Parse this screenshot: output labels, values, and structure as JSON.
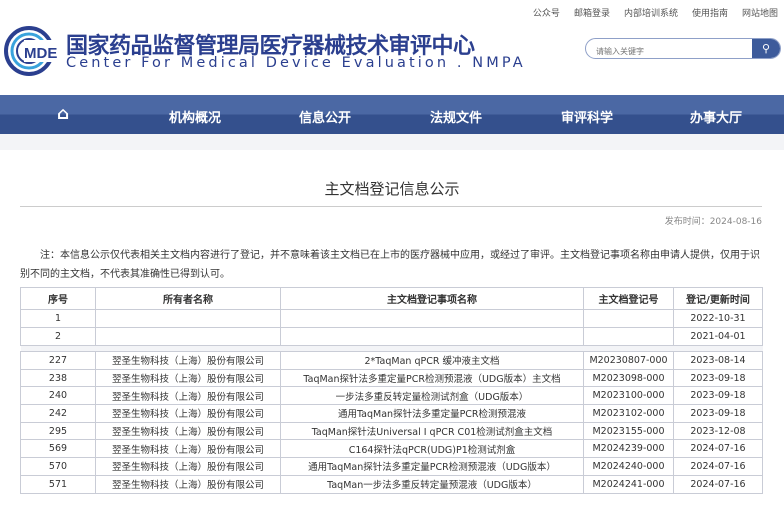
{
  "toplinks": [
    "公众号",
    "邮箱登录",
    "内部培训系统",
    "使用指南",
    "网站地图"
  ],
  "logo_text": "MDE",
  "site_title_cn": "国家药品监督管理局医疗器械技术审评中心",
  "site_title_en": "Center For Medical Device Evaluation . NMPA",
  "search": {
    "placeholder": "请输入关键字"
  },
  "nav": [
    "机构概况",
    "信息公开",
    "法规文件",
    "审评科学",
    "办事大厅"
  ],
  "page_title": "主文档登记信息公示",
  "publish_date": "发布时间：2024-08-16",
  "note": "注：本信息公示仅代表相关主文档内容进行了登记，并不意味着该主文档已在上市的医疗器械中应用，或经过了审评。主文档登记事项名称由申请人提供，仅用于识别不同的主文档，不代表其准确性已得到认可。",
  "table": {
    "headers": [
      "序号",
      "所有者名称",
      "主文档登记事项名称",
      "主文档登记号",
      "登记/更新时间"
    ],
    "top_rows": [
      [
        "1",
        "",
        "",
        "",
        "2022-10-31"
      ],
      [
        "2",
        "",
        "",
        "",
        "2021-04-01"
      ]
    ],
    "rows": [
      [
        "227",
        "翌圣生物科技（上海）股份有限公司",
        "2*TaqMan qPCR 缓冲液主文档",
        "M20230807-000",
        "2023-08-14"
      ],
      [
        "238",
        "翌圣生物科技（上海）股份有限公司",
        "TaqMan探针法多重定量PCR检测预混液（UDG版本）主文档",
        "M2023098-000",
        "2023-09-18"
      ],
      [
        "240",
        "翌圣生物科技（上海）股份有限公司",
        "一步法多重反转定量检测试剂盒（UDG版本）",
        "M2023100-000",
        "2023-09-18"
      ],
      [
        "242",
        "翌圣生物科技（上海）股份有限公司",
        "通用TaqMan探针法多重定量PCR检测预混液",
        "M2023102-000",
        "2023-09-18"
      ],
      [
        "295",
        "翌圣生物科技（上海）股份有限公司",
        "TaqMan探针法Universal I qPCR C01检测试剂盒主文档",
        "M2023155-000",
        "2023-12-08"
      ],
      [
        "569",
        "翌圣生物科技（上海）股份有限公司",
        "C164探针法qPCR(UDG)P1检测试剂盒",
        "M2024239-000",
        "2024-07-16"
      ],
      [
        "570",
        "翌圣生物科技（上海）股份有限公司",
        "通用TaqMan探针法多重定量PCR检测预混液（UDG版本）",
        "M2024240-000",
        "2024-07-16"
      ],
      [
        "571",
        "翌圣生物科技（上海）股份有限公司",
        "TaqMan一步法多重反转定量预混液（UDG版本）",
        "M2024241-000",
        "2024-07-16"
      ]
    ]
  },
  "colors": {
    "brand": "#2b3f8f",
    "nav_top": "#4b68a4",
    "nav_bottom": "#34508d"
  }
}
